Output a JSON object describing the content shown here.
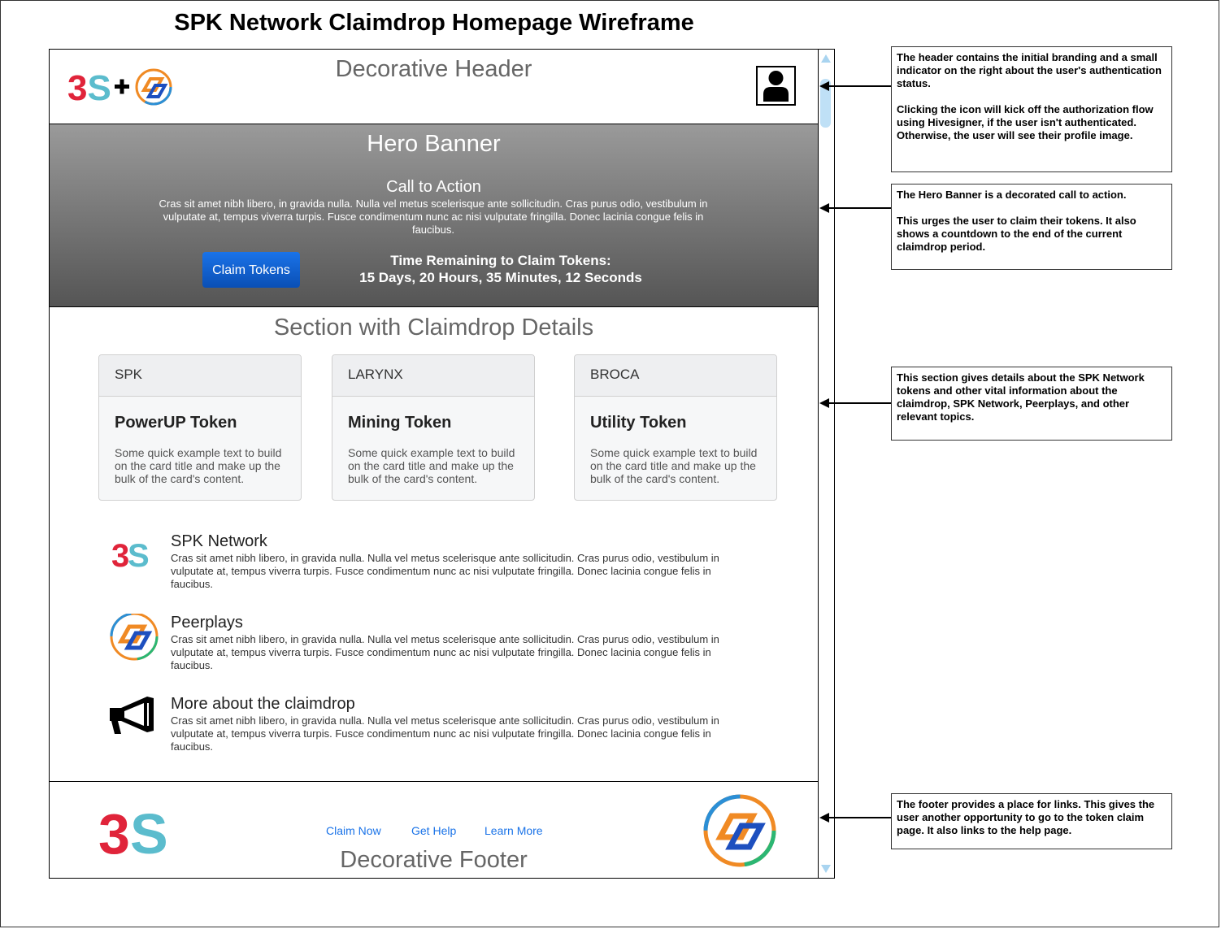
{
  "title": "SPK Network Claimdrop Homepage Wireframe",
  "header": {
    "title": "Decorative Header",
    "logo_text": "3S"
  },
  "hero": {
    "title": "Hero Banner",
    "cta_title": "Call to Action",
    "text": "Cras sit amet nibh libero, in gravida nulla. Nulla vel metus scelerisque ante sollicitudin. Cras purus odio, vestibulum in vulputate at, tempus viverra turpis. Fusce condimentum nunc ac nisi vulputate fringilla. Donec lacinia congue felis in faucibus.",
    "button_label": "Claim Tokens",
    "countdown_label": "Time Remaining to Claim Tokens:",
    "countdown_value": "15 Days, 20 Hours, 35 Minutes, 12 Seconds"
  },
  "details": {
    "title": "Section with Claimdrop Details",
    "cards": [
      {
        "head": "SPK",
        "title": "PowerUP Token",
        "text": "Some quick example text to build on the card title and make up the bulk of the card's content."
      },
      {
        "head": "LARYNX",
        "title": "Mining Token",
        "text": "Some quick example text to build on the card title and make up the bulk of the card's content."
      },
      {
        "head": "BROCA",
        "title": "Utility Token",
        "text": "Some quick example text to build on the card title and make up the bulk of the card's content."
      }
    ],
    "items": [
      {
        "title": "SPK Network",
        "text": "Cras sit amet nibh libero, in gravida nulla. Nulla vel metus scelerisque ante sollicitudin. Cras purus odio, vestibulum in vulputate at, tempus viverra turpis. Fusce condimentum nunc ac nisi vulputate fringilla. Donec lacinia congue felis in faucibus."
      },
      {
        "title": "Peerplays",
        "text": "Cras sit amet nibh libero, in gravida nulla. Nulla vel metus scelerisque ante sollicitudin. Cras purus odio, vestibulum in vulputate at, tempus viverra turpis. Fusce condimentum nunc ac nisi vulputate fringilla. Donec lacinia congue felis in faucibus."
      },
      {
        "title": "More about the claimdrop",
        "text": "Cras sit amet nibh libero, in gravida nulla. Nulla vel metus scelerisque ante sollicitudin. Cras purus odio, vestibulum in vulputate at, tempus viverra turpis. Fusce condimentum nunc ac nisi vulputate fringilla. Donec lacinia congue felis in faucibus."
      }
    ]
  },
  "footer": {
    "title": "Decorative Footer",
    "links": [
      "Claim Now",
      "Get Help",
      "Learn More"
    ],
    "logo_text": "3S"
  },
  "annotations": {
    "header_p1": "The header contains the initial branding and a small indicator on the right about the user's authentication status.",
    "header_p2": "Clicking the icon will kick off the authorization flow using Hivesigner, if the user isn't authenticated. Otherwise, the user will see their profile image.",
    "hero_p1": "The Hero Banner is a decorated call to action.",
    "hero_p2": "This urges the user to claim their tokens. It also shows a countdown to the end of the current claimdrop period.",
    "details_p1": "This section gives details about the SPK Network tokens and other vital information about the claimdrop, SPK Network, Peerplays, and other relevant topics.",
    "footer_p1": "The footer provides a place for links. This gives the user another opportunity to go to the token claim page. It also links to the help page."
  },
  "colors": {
    "link": "#1a73e8",
    "button": "#0a5fd1",
    "spk_red": "#e0243a",
    "spk_teal": "#5bbccd"
  },
  "icons": [
    "spk-logo-icon",
    "plus-icon",
    "peerplays-logo-icon",
    "user-profile-icon",
    "megaphone-icon",
    "scroll-up-icon",
    "scroll-down-icon"
  ]
}
